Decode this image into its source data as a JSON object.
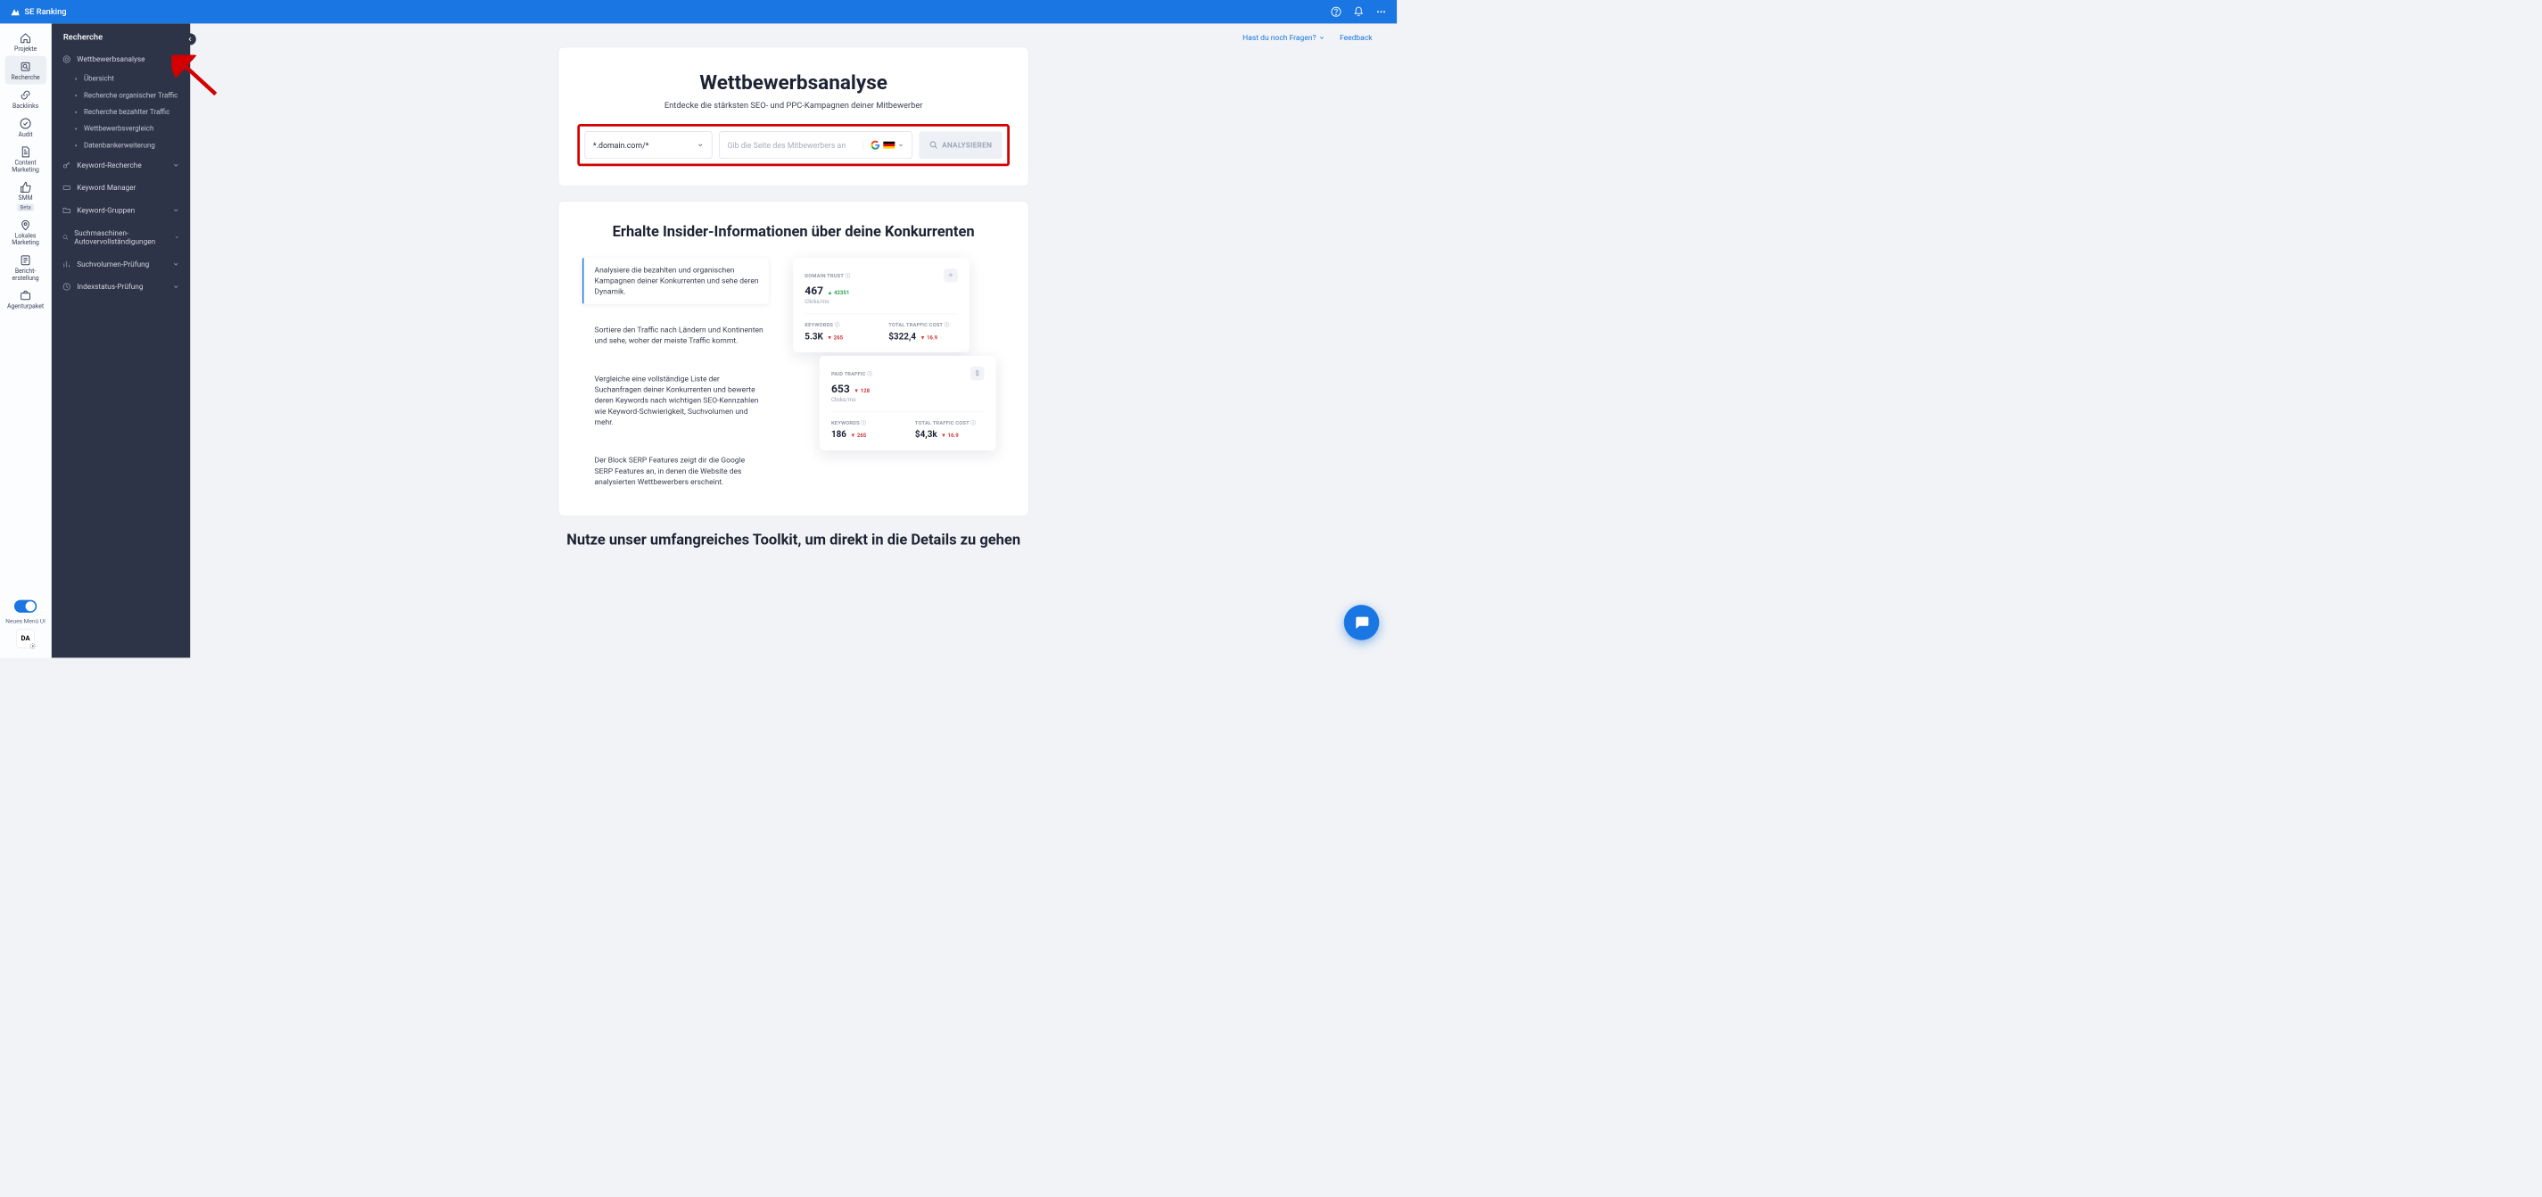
{
  "topbar": {
    "brand": "SE Ranking"
  },
  "rail": {
    "items": [
      {
        "label": "Projekte",
        "icon": "home"
      },
      {
        "label": "Recherche",
        "icon": "search",
        "active": true
      },
      {
        "label": "Backlinks",
        "icon": "link"
      },
      {
        "label": "Audit",
        "icon": "check"
      },
      {
        "label": "Content Marketing",
        "icon": "doc"
      },
      {
        "label": "SMM",
        "icon": "thumb",
        "badge": "Beta"
      },
      {
        "label": "Lokales Marketing",
        "icon": "pin"
      },
      {
        "label": "Bericht-erstellung",
        "icon": "report"
      },
      {
        "label": "Agenturpaket",
        "icon": "case"
      }
    ],
    "toggle_label": "Neues Menü UI",
    "da": "DA"
  },
  "sidebar": {
    "title": "Recherche",
    "groups": [
      {
        "label": "Wettbewerbsanalyse",
        "icon": "target",
        "expanded": true,
        "items": [
          "Übersicht",
          "Recherche organischer Traffic",
          "Recherche bezahlter Traffic",
          "Wettbewerbsvergleich",
          "Datenbankerweiterung"
        ]
      },
      {
        "label": "Keyword-Recherche",
        "icon": "key"
      },
      {
        "label": "Keyword Manager",
        "icon": "kbd",
        "noChev": true
      },
      {
        "label": "Keyword-Gruppen",
        "icon": "folder"
      },
      {
        "label": "Suchmaschinen-Autovervollständigungen",
        "icon": "auto"
      },
      {
        "label": "Suchvolumen-Prüfung",
        "icon": "bars"
      },
      {
        "label": "Indexstatus-Prüfung",
        "icon": "index"
      }
    ]
  },
  "top_links": {
    "faq": "Hast du noch Fragen?",
    "feedback": "Feedback"
  },
  "hero": {
    "title": "Wettbewerbsanalyse",
    "subtitle": "Entdecke die stärksten SEO- und PPC-Kampagnen deiner Mitbewerber",
    "select": "*.domain.com/*",
    "placeholder": "Gib die Seite des Mitbewerbers an",
    "button": "ANALYSIEREN"
  },
  "info": {
    "title": "Erhalte Insider-Informationen über deine Konkurrenten",
    "bullets": [
      "Analysiere die bezahlten und organischen Kampagnen deiner Konkurrenten und sehe deren Dynamik.",
      "Sortiere den Traffic nach Ländern und Kontinenten und sehe, woher der meiste Traffic kommt.",
      "Vergleiche eine vollständige Liste der Suchanfragen deiner Konkurrenten und bewerte deren Keywords nach wichtigen SEO-Kennzahlen wie Keyword-Schwierigkeit, Suchvolumen und mehr.",
      "Der Block SERP Features zeigt dir die Google SERP Features an, in denen die Website des analysierten Wettbewerbers erscheint."
    ],
    "preview": {
      "card1": {
        "lbl": "DOMAIN TRUST",
        "val": "467",
        "delta": "42351",
        "sub": "Clicks/mo",
        "k_lbl": "KEYWORDS",
        "k_val": "5.3K",
        "k_delta": "265",
        "c_lbl": "TOTAL TRAFFIC COST",
        "c_val": "$322,4",
        "c_delta": "16.9"
      },
      "card2": {
        "lbl": "PAID TRAFFIC",
        "val": "653",
        "delta": "128",
        "sub": "Clicks/mo",
        "badge": "$",
        "k_lbl": "KEYWORDS",
        "k_val": "186",
        "k_delta": "265",
        "c_lbl": "TOTAL TRAFFIC COST",
        "c_val": "$4,3k",
        "c_delta": "16.9"
      }
    }
  },
  "toolkit": {
    "title": "Nutze unser umfangreiches Toolkit, um direkt in die Details zu gehen"
  }
}
